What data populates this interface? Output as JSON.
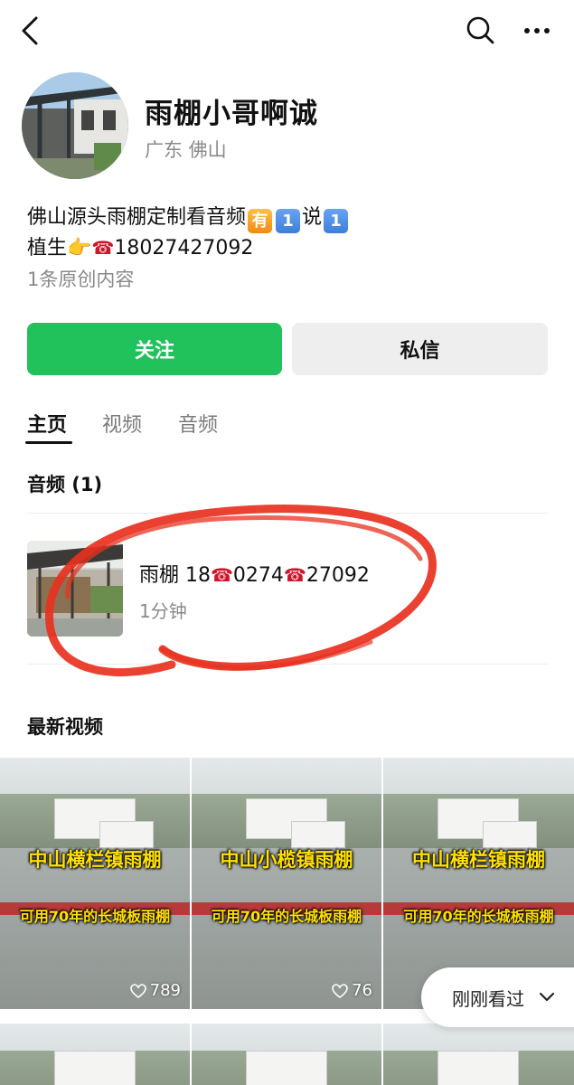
{
  "profile": {
    "name": "雨棚小哥啊诚",
    "location": "广东 佛山",
    "bio_line1_text": "佛山源头雨棚定制看音频",
    "bio_line1_badge1": "有",
    "bio_line1_badge2": "1",
    "bio_line1_say": "说",
    "bio_line1_badge3": "1",
    "bio_line2_prefix": "植生",
    "bio_line2_point": "👉",
    "bio_line2_phone_icon": "☎",
    "bio_line2_number": "18027427092",
    "original_count": "1条原创内容"
  },
  "actions": {
    "follow_label": "关注",
    "message_label": "私信"
  },
  "tabs": [
    {
      "label": "主页",
      "active": true
    },
    {
      "label": "视频",
      "active": false
    },
    {
      "label": "音频",
      "active": false
    }
  ],
  "audio_section": {
    "title": "音频 (1)",
    "items": [
      {
        "title_a": "雨棚 18",
        "title_icon": "☎",
        "title_b": "0274",
        "title_c": "27092",
        "duration": "1分钟"
      }
    ]
  },
  "video_section": {
    "title": "最新视频",
    "videos": [
      {
        "title": "中山横栏镇雨棚",
        "subtitle": "可用70年的长城板雨棚",
        "likes": "789"
      },
      {
        "title": "中山小榄镇雨棚",
        "subtitle": "可用70年的长城板雨棚",
        "likes": "76"
      },
      {
        "title": "中山横栏镇雨棚",
        "subtitle": "可用70年的长城板雨棚",
        "likes": ""
      }
    ]
  },
  "recent": {
    "label": "刚刚看过"
  },
  "colors": {
    "follow_green": "#21c15c",
    "annotation_red": "#e8311f",
    "caption_yellow": "#ffe000"
  },
  "icons": {
    "back": "back-icon",
    "search": "search-icon",
    "more": "more-icon",
    "heart": "heart-icon",
    "chevron": "chevron-down-icon"
  }
}
